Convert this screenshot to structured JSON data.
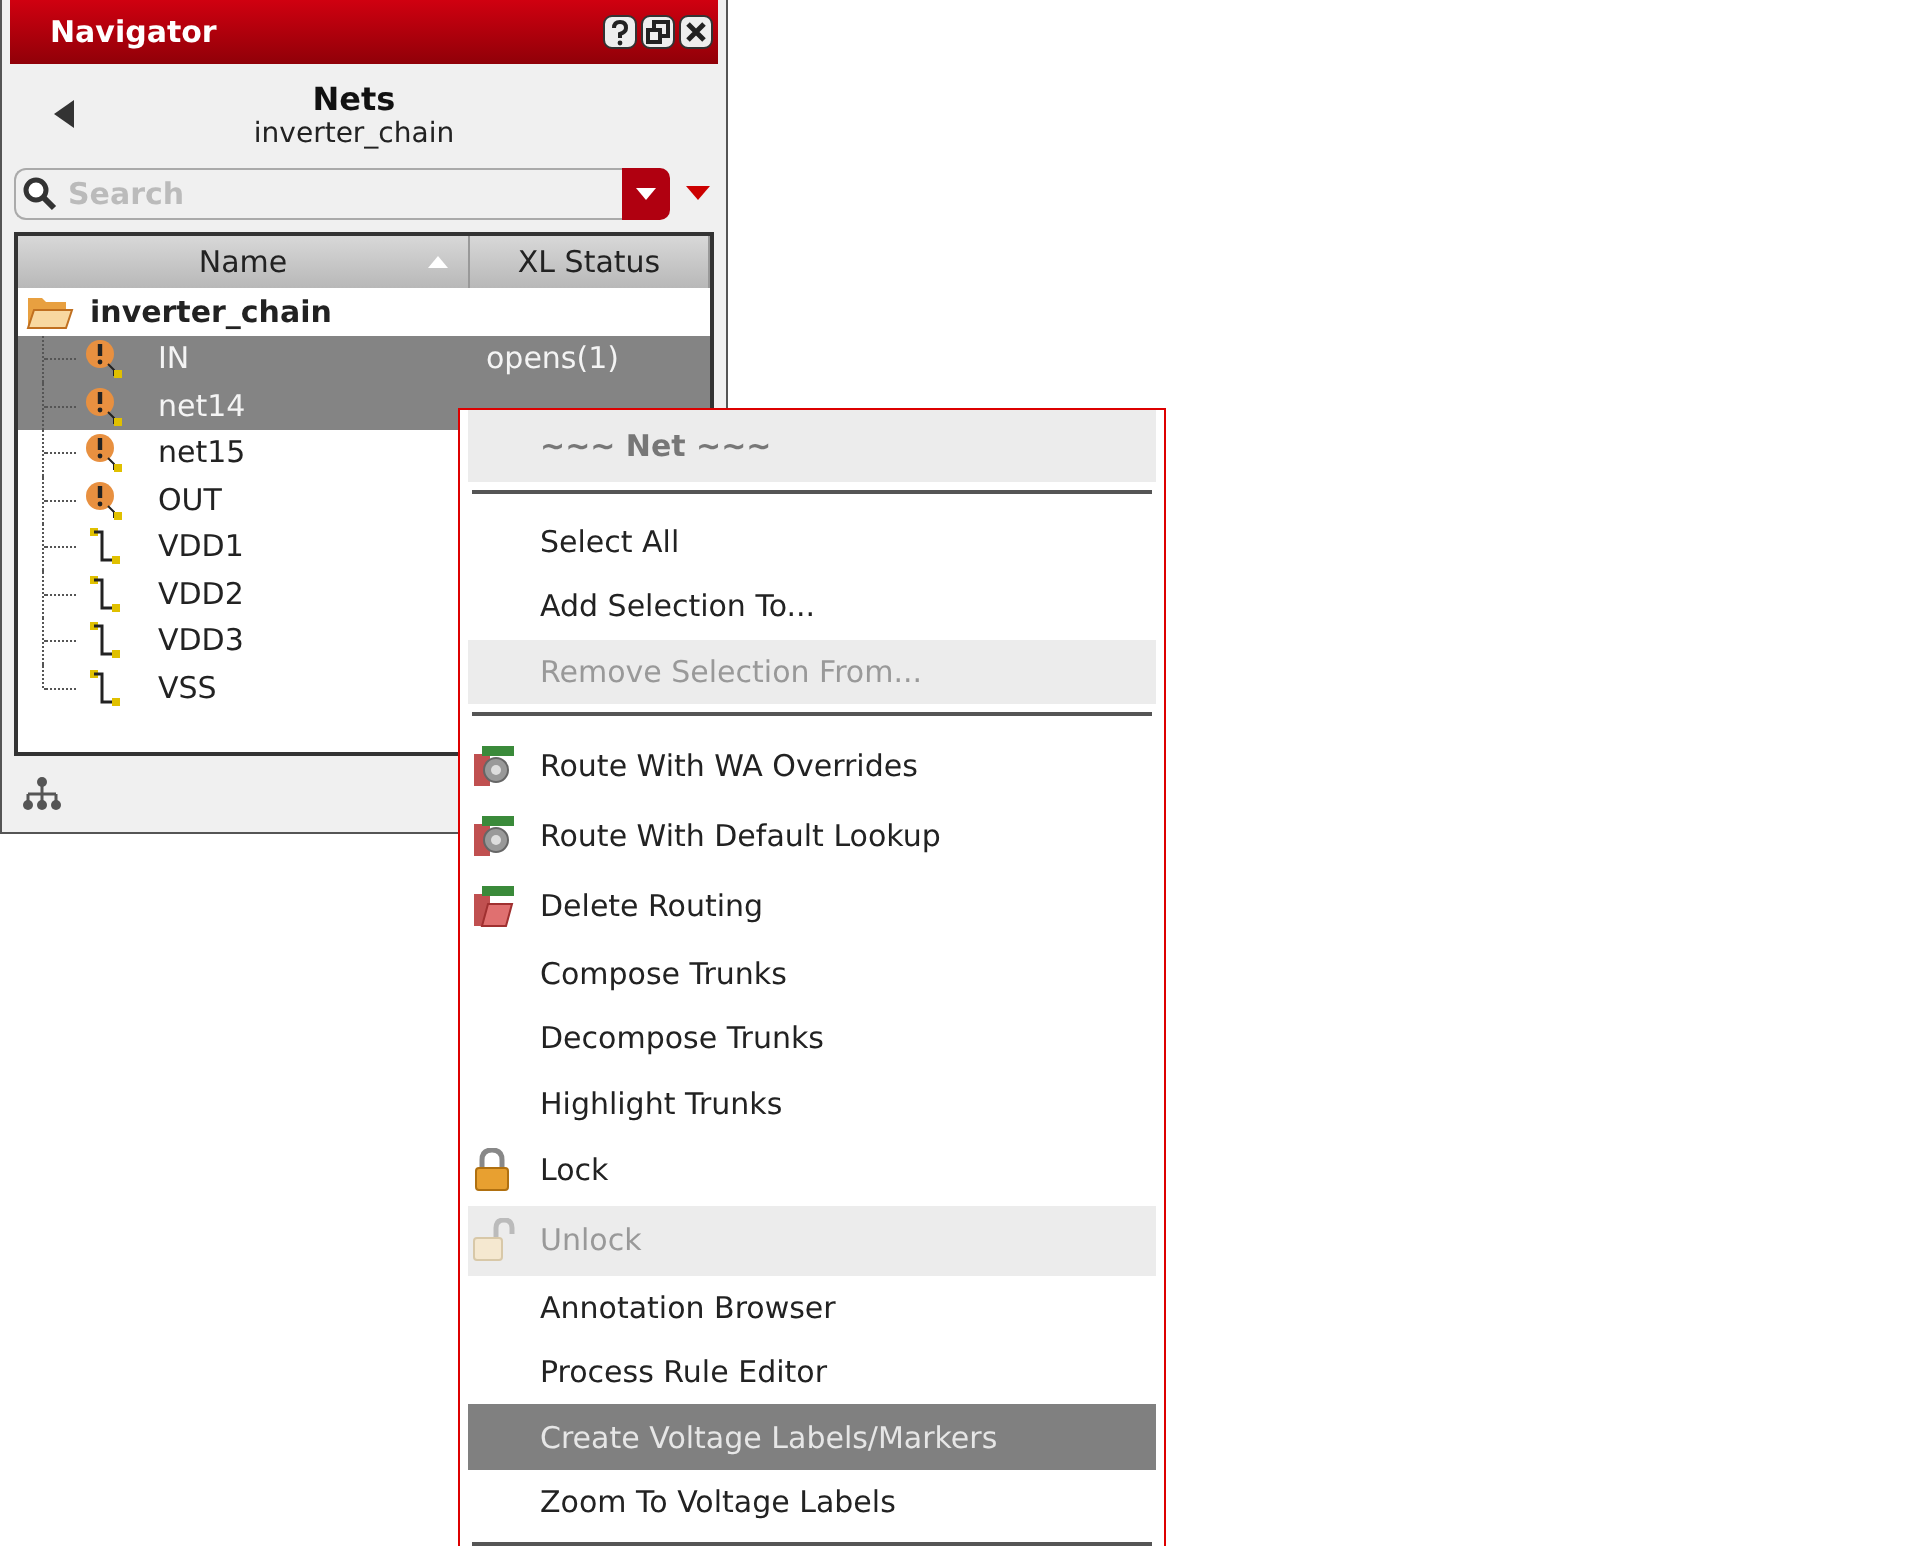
{
  "window": {
    "title": "Navigator"
  },
  "header": {
    "title": "Nets",
    "subtitle": "inverter_chain"
  },
  "search": {
    "placeholder": "Search"
  },
  "table": {
    "columns": [
      {
        "label": "Name",
        "sorted": true
      },
      {
        "label": "XL Status",
        "sorted": false
      }
    ],
    "tree": {
      "label": "inverter_chain",
      "expanded": true,
      "children": [
        {
          "label": "IN",
          "kind": "warning",
          "status": "opens(1)",
          "selected": true
        },
        {
          "label": "net14",
          "kind": "warning",
          "selected": true
        },
        {
          "label": "net15",
          "kind": "warning",
          "selected": false
        },
        {
          "label": "OUT",
          "kind": "warning",
          "selected": false
        },
        {
          "label": "VDD1",
          "kind": "net",
          "selected": false
        },
        {
          "label": "VDD2",
          "kind": "net",
          "selected": false
        },
        {
          "label": "VDD3",
          "kind": "net",
          "selected": false
        },
        {
          "label": "VSS",
          "kind": "net",
          "selected": false
        }
      ]
    }
  },
  "menu": {
    "items": [
      {
        "kind": "header",
        "label": "~~~ Net ~~~"
      },
      {
        "kind": "separator"
      },
      {
        "kind": "item",
        "label": "Select All",
        "disabled": false,
        "selected": false
      },
      {
        "kind": "item",
        "label": "Add Selection To...",
        "disabled": false,
        "selected": false
      },
      {
        "kind": "item",
        "label": "Remove Selection From...",
        "disabled": true,
        "selected": false
      },
      {
        "kind": "separator"
      },
      {
        "kind": "route",
        "label": "Route With WA Overrides",
        "disabled": false,
        "selected": false
      },
      {
        "kind": "route",
        "label": "Route With Default Lookup",
        "disabled": false,
        "selected": false
      },
      {
        "kind": "delete",
        "label": "Delete Routing",
        "disabled": false,
        "selected": false
      },
      {
        "kind": "item",
        "label": "Compose Trunks",
        "disabled": false,
        "selected": false
      },
      {
        "kind": "item",
        "label": "Decompose Trunks",
        "disabled": false,
        "selected": false
      },
      {
        "kind": "item",
        "label": "Highlight Trunks",
        "disabled": false,
        "selected": false
      },
      {
        "kind": "lock",
        "label": "Lock",
        "disabled": false,
        "selected": false
      },
      {
        "kind": "unlock",
        "label": "Unlock",
        "disabled": true,
        "selected": false
      },
      {
        "kind": "item",
        "label": "Annotation Browser",
        "disabled": false,
        "selected": false
      },
      {
        "kind": "item",
        "label": "Process Rule Editor",
        "disabled": false,
        "selected": false
      },
      {
        "kind": "item",
        "label": "Create Voltage Labels/Markers",
        "disabled": false,
        "selected": true
      },
      {
        "kind": "item",
        "label": "Zoom To Voltage Labels",
        "disabled": false,
        "selected": false
      },
      {
        "kind": "separator"
      }
    ]
  }
}
